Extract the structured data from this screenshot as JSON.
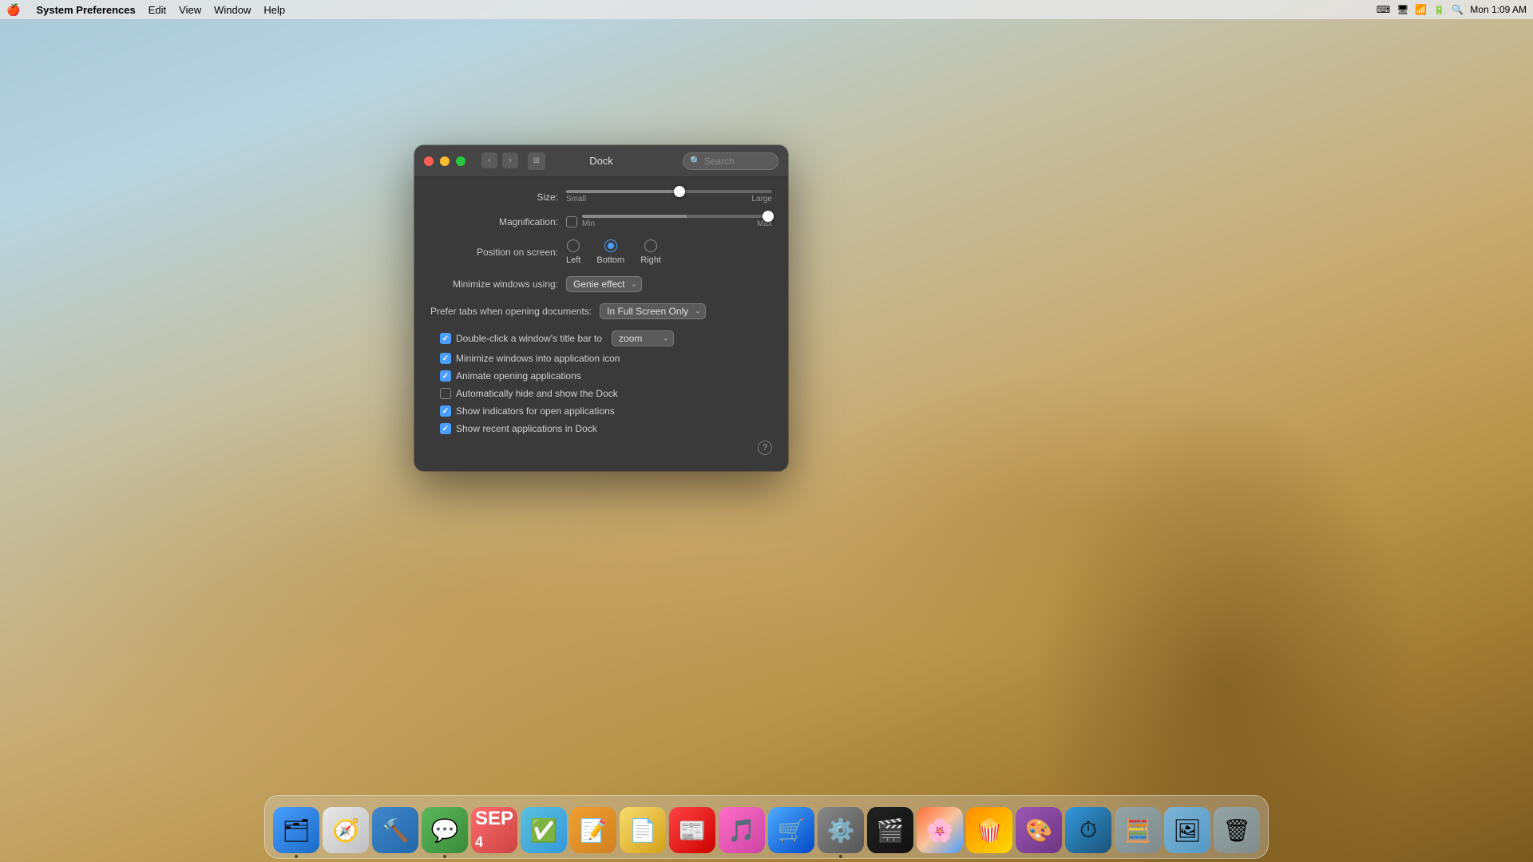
{
  "menubar": {
    "apple": "🍎",
    "app_name": "System Preferences",
    "menus": [
      "Edit",
      "View",
      "Window",
      "Help"
    ],
    "time": "Mon 1:09 AM",
    "right_icons": [
      "⌨",
      "📺",
      "📶",
      "🔋",
      "🔍"
    ]
  },
  "window": {
    "title": "Dock",
    "search_placeholder": "Search",
    "settings": {
      "size_label": "Size:",
      "size_min": "Small",
      "size_max": "Large",
      "magnification_label": "Magnification:",
      "mag_min": "Min",
      "mag_max": "Max",
      "position_label": "Position on screen:",
      "position_options": [
        {
          "label": "Left",
          "selected": false
        },
        {
          "label": "Bottom",
          "selected": true
        },
        {
          "label": "Right",
          "selected": false
        }
      ],
      "minimize_label": "Minimize windows using:",
      "minimize_value": "Genie effect",
      "tabs_label": "Prefer tabs when opening documents:",
      "tabs_value": "In Full Screen Only",
      "checkboxes": [
        {
          "label": "Double-click a window's title bar to",
          "checked": true,
          "has_select": true,
          "select_value": "zoom"
        },
        {
          "label": "Minimize windows into application icon",
          "checked": true,
          "has_select": false
        },
        {
          "label": "Animate opening applications",
          "checked": true,
          "has_select": false
        },
        {
          "label": "Automatically hide and show the Dock",
          "checked": false,
          "has_select": false
        },
        {
          "label": "Show indicators for open applications",
          "checked": true,
          "has_select": false
        },
        {
          "label": "Show recent applications in Dock",
          "checked": true,
          "has_select": false
        }
      ]
    }
  },
  "dock": {
    "items": [
      {
        "name": "Finder",
        "icon": "finder"
      },
      {
        "name": "Safari",
        "icon": "safari"
      },
      {
        "name": "Xcode",
        "icon": "xcode"
      },
      {
        "name": "Messages",
        "icon": "messages"
      },
      {
        "name": "Calendar",
        "icon": "calendar"
      },
      {
        "name": "OmniFocus",
        "icon": "tasks"
      },
      {
        "name": "Sublime Text",
        "icon": "sublime"
      },
      {
        "name": "Stickies",
        "icon": "stickies"
      },
      {
        "name": "News",
        "icon": "news"
      },
      {
        "name": "iTunes",
        "icon": "itunes"
      },
      {
        "name": "App Store",
        "icon": "appstore"
      },
      {
        "name": "System Preferences",
        "icon": "sysprefs"
      },
      {
        "name": "Final Cut Pro",
        "icon": "clapper"
      },
      {
        "name": "Photos",
        "icon": "photos"
      },
      {
        "name": "Popcorn",
        "icon": "popcorn"
      },
      {
        "name": "Affinity Photo",
        "icon": "affinity"
      },
      {
        "name": "Timing",
        "icon": "timing"
      },
      {
        "name": "Calculator",
        "icon": "calculator"
      },
      {
        "name": "Preview",
        "icon": "preview"
      },
      {
        "name": "Trash",
        "icon": "trash"
      }
    ]
  },
  "labels": {
    "zoom": "zoom",
    "genie_effect": "Genie effect",
    "in_full_screen_only": "In Full Screen Only",
    "help": "?"
  }
}
